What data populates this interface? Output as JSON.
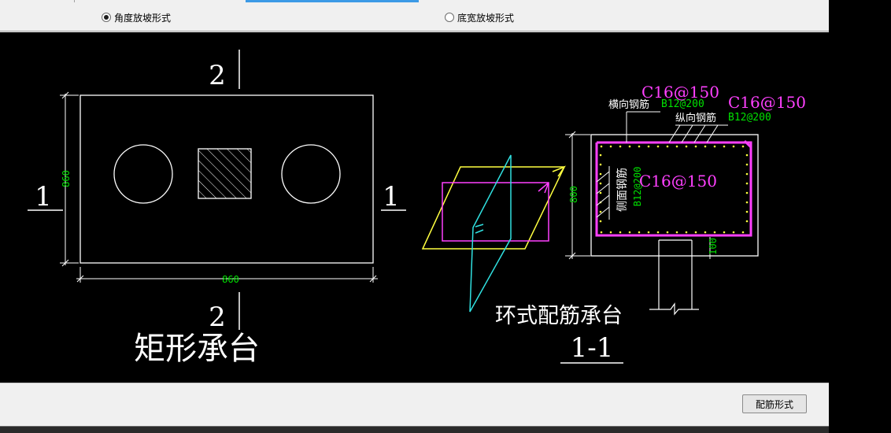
{
  "options": {
    "angle_label": "角度放坡形式",
    "width_label": "底宽放坡形式"
  },
  "drawing": {
    "plan": {
      "section_mark_top": "2",
      "section_mark_bottom": "2",
      "section_mark_left": "1",
      "section_mark_right": "1",
      "dim_height": "860",
      "dim_width": "860",
      "title": "矩形承台"
    },
    "ring": {
      "title": "环式配筋承台"
    },
    "section": {
      "title": "1-1",
      "dim_height": "800",
      "dim_bottom": "100",
      "transverse_label": "横向钢筋",
      "transverse_value": "B12@200",
      "transverse_override": "C16@150",
      "longitudinal_label": "纵向钢筋",
      "longitudinal_value": "B12@200",
      "longitudinal_override": "C16@150",
      "side_label": "侧面钢筋",
      "side_value": "B12@200",
      "side_override": "C16@150"
    }
  },
  "footer": {
    "rebar_button": "配筋形式"
  }
}
